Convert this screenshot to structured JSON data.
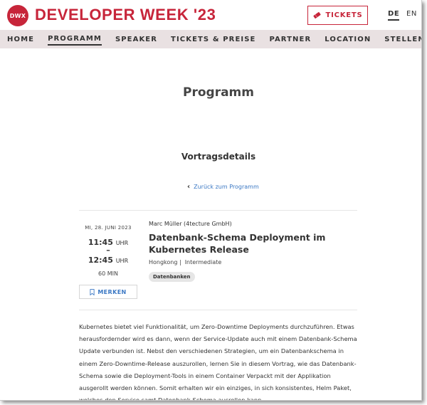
{
  "header": {
    "logo_text": "DWX",
    "brand": "DEVELOPER WEEK '23",
    "tickets_label": "TICKETS",
    "languages": [
      "DE",
      "EN"
    ],
    "active_language": "DE",
    "accent_color": "#c7253a"
  },
  "nav": {
    "items": [
      "HOME",
      "PROGRAMM",
      "SPEAKER",
      "TICKETS & PREISE",
      "PARTNER",
      "LOCATION",
      "STELLENMARKT"
    ],
    "active": "PROGRAMM"
  },
  "page": {
    "title": "Programm",
    "section_title": "Vortragsdetails",
    "back_link": "Zurück zum Programm"
  },
  "talk": {
    "date": "MI, 28. JUNI 2023",
    "start_time": "11:45",
    "end_time": "12:45",
    "time_unit": "UHR",
    "dash": "–",
    "duration": "60 MIN",
    "bookmark_label": "MERKEN",
    "speaker": "Marc Müller (4tecture GmbH)",
    "title": "Datenbank-Schema Deployment im Kubernetes Release",
    "room": "Hongkong |",
    "level": "Intermediate",
    "tag": "Datenbanken",
    "description": "Kubernetes bietet viel Funktionalität, um Zero-Downtime Deployments durchzuführen. Etwas herausfordernder wird es dann, wenn der Service-Update auch mit einem Datenbank-Schema Update verbunden ist. Nebst den verschiedenen Strategien, um ein Datenbankschema in einem Zero-Downtime-Release auszurollen, lernen Sie in diesem Vortrag, wie das Datenbank-Schema sowie die Deployment-Tools in einem Container Verpackt mit der Applikation ausgerollt werden können. Somit erhalten wir ein einziges, in sich konsistentes, Helm Paket, welches den Service samt Datenbank-Schema ausrollen kann."
  },
  "icons": {
    "tickets": "ticket-icon",
    "back": "chevron-left-icon",
    "bookmark": "bookmark-icon"
  }
}
